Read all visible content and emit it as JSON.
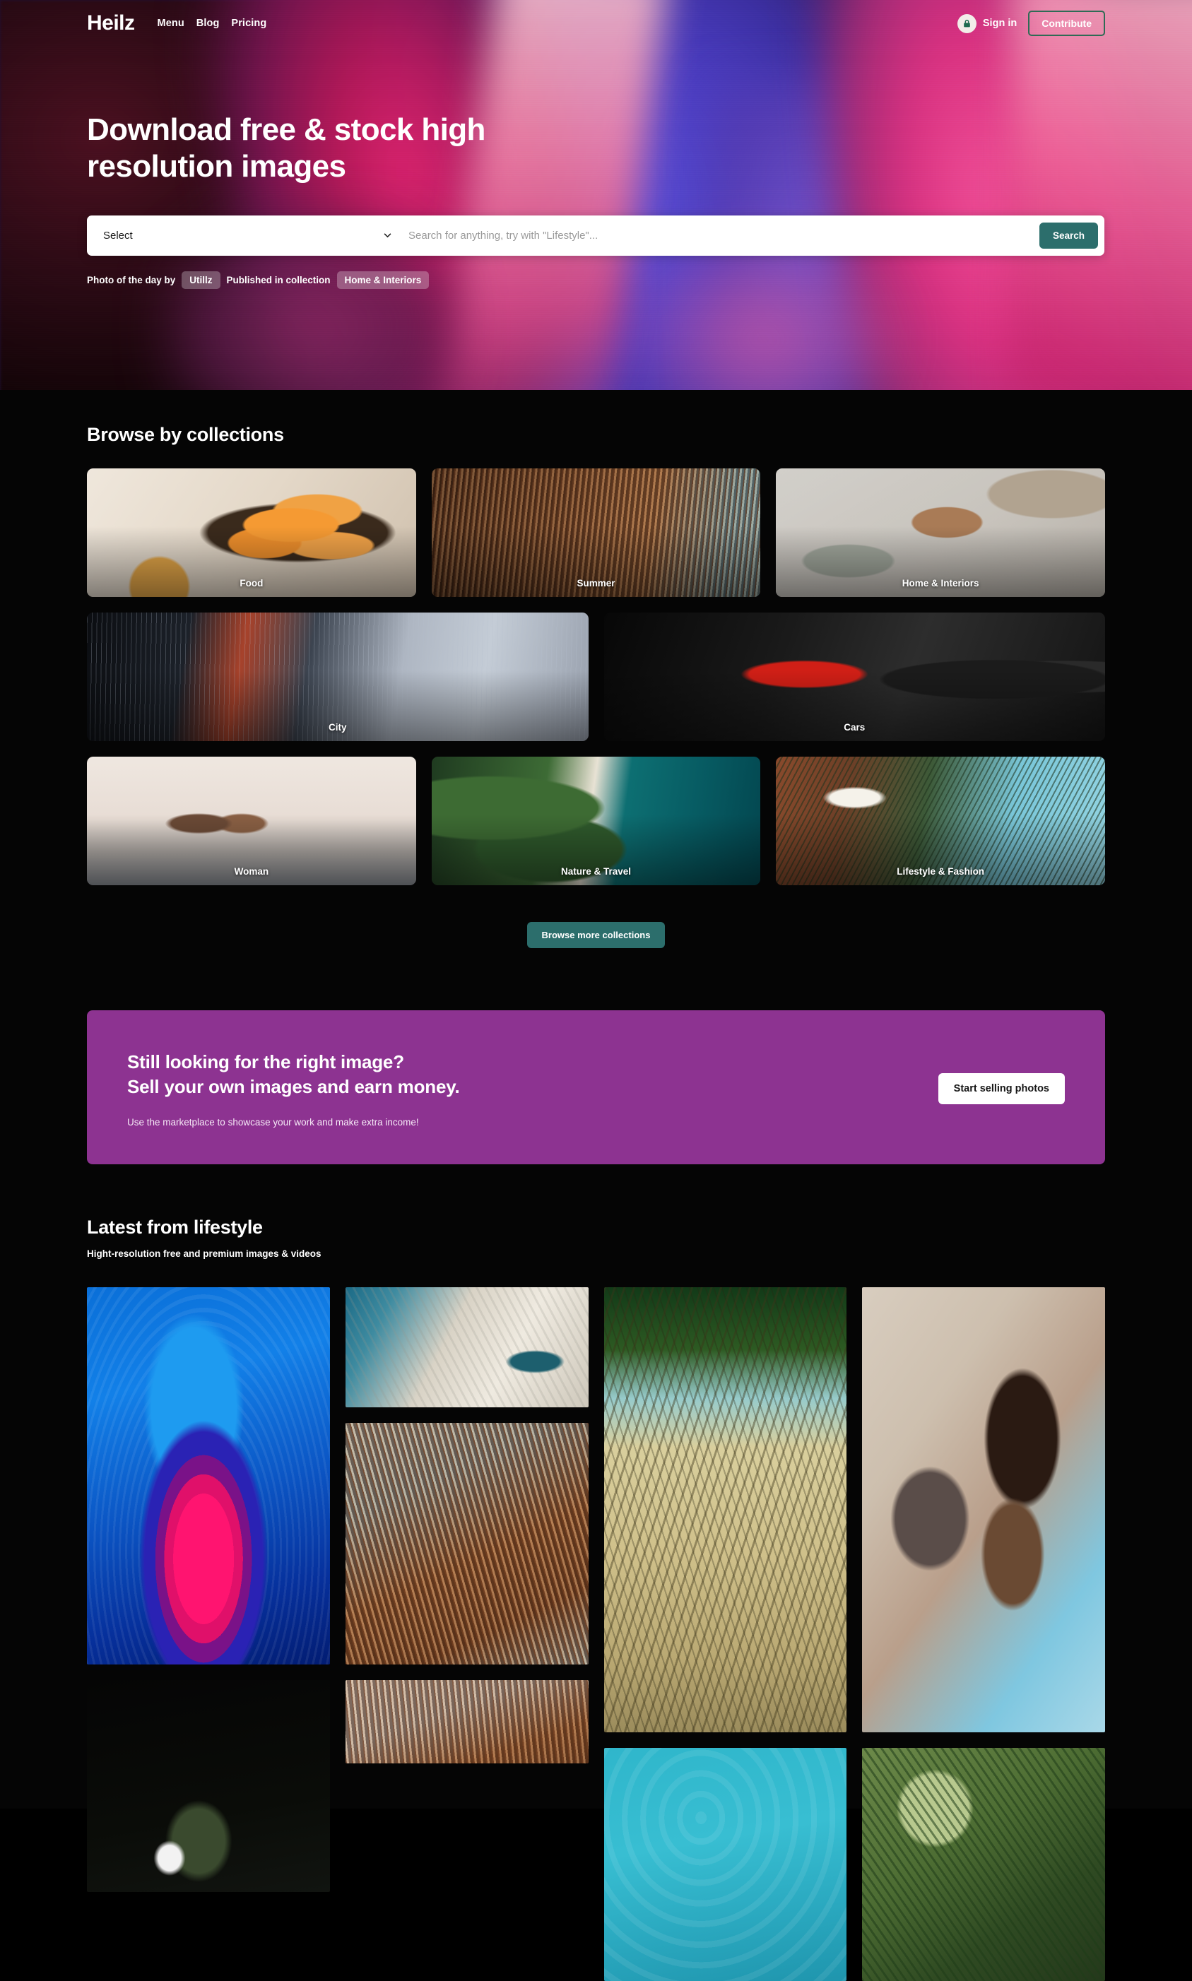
{
  "nav": {
    "logo": "Heilz",
    "links": [
      "Menu",
      "Blog",
      "Pricing"
    ],
    "sign_in": "Sign in",
    "contribute": "Contribute"
  },
  "hero": {
    "title": "Download free & stock high resolution images",
    "search": {
      "select_value": "Select",
      "select_options": [
        "Select"
      ],
      "placeholder": "Search for anything, try with \"Lifestyle\"...",
      "button": "Search"
    },
    "photo_of_day": {
      "prefix": "Photo of the day by",
      "author": "Utillz",
      "middle": "Published in collection",
      "collection": "Home & Interiors"
    }
  },
  "collections": {
    "heading": "Browse by collections",
    "rows": [
      [
        {
          "label": "Food",
          "art": "art-food",
          "wide": false
        },
        {
          "label": "Summer",
          "art": "art-summer",
          "wide": false
        },
        {
          "label": "Home & Interiors",
          "art": "art-home",
          "wide": false
        }
      ],
      [
        {
          "label": "City",
          "art": "art-city",
          "wide": true
        },
        {
          "label": "Cars",
          "art": "art-cars",
          "wide": true
        }
      ],
      [
        {
          "label": "Woman",
          "art": "art-woman",
          "wide": false
        },
        {
          "label": "Nature & Travel",
          "art": "art-nature",
          "wide": false
        },
        {
          "label": "Lifestyle & Fashion",
          "art": "art-lifestyle",
          "wide": false
        }
      ]
    ],
    "browse_more": "Browse more collections"
  },
  "cta": {
    "line1": "Still looking for the right image?",
    "line2": "Sell your own images and earn money.",
    "sub": "Use the marketplace to showcase your work and make extra income!",
    "button": "Start selling photos",
    "bg_color": "#8d3391"
  },
  "latest": {
    "heading": "Latest from lifestyle",
    "subheading": "Hight-resolution free and premium images & videos",
    "columns": [
      [
        {
          "art": "ph-agate"
        },
        {
          "art": "ph-dark"
        }
      ],
      [
        {
          "art": "ph-deck"
        },
        {
          "art": "ph-umbrella"
        },
        {
          "art": "ph-umbrella2"
        }
      ],
      [
        {
          "art": "ph-palm"
        },
        {
          "art": "ph-water"
        }
      ],
      [
        {
          "art": "ph-woman"
        },
        {
          "art": "ph-leaves"
        }
      ]
    ]
  },
  "theme": {
    "accent_teal": "#2c6e6c",
    "accent_purple": "#8d3391",
    "background": "#050505",
    "contribute_border": "#2f6b55"
  }
}
